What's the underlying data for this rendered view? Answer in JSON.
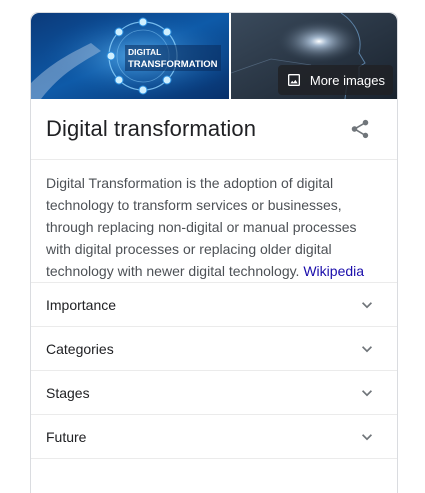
{
  "title": "Digital transformation",
  "images": {
    "left_caption_line1": "DIGITAL",
    "left_caption_line2": "TRANSFORMATION",
    "more_images_label": "More images"
  },
  "description": {
    "text": "Digital Transformation is the adoption of digital technology to transform services or businesses, through replacing non-digital or manual processes with digital processes or replacing older digital technology with newer digital technology.",
    "source_link": "Wikipedia"
  },
  "sections": [
    {
      "label": "Importance"
    },
    {
      "label": "Categories"
    },
    {
      "label": "Stages"
    },
    {
      "label": "Future"
    }
  ],
  "colors": {
    "link": "#1a0dab",
    "border": "#dadce0",
    "text_secondary": "#4d5156"
  },
  "icons": {
    "share": "share-icon",
    "image": "image-icon",
    "expand": "chevron-down-icon"
  }
}
